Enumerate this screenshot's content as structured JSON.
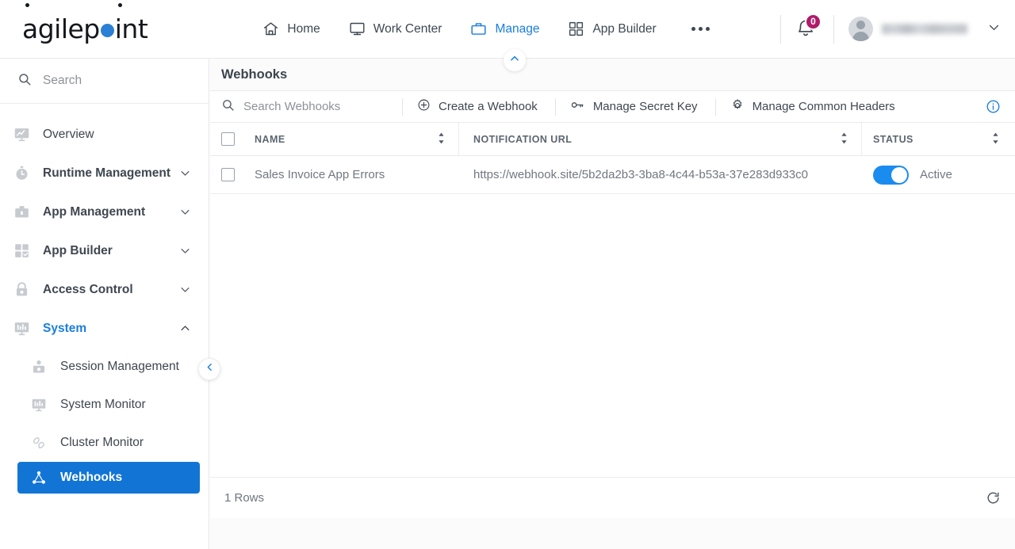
{
  "brand": {
    "logo_text_1": "agilep",
    "logo_dot": "blue-circle-dot",
    "logo_text_2": "int"
  },
  "topnav": {
    "items": [
      {
        "label": "Home",
        "icon": "home-icon",
        "active": false
      },
      {
        "label": "Work Center",
        "icon": "monitor-icon",
        "active": false
      },
      {
        "label": "Manage",
        "icon": "briefcase-icon",
        "active": true
      },
      {
        "label": "App Builder",
        "icon": "grid-icon",
        "active": false
      }
    ],
    "more_icon": "ellipsis-icon",
    "notification_icon": "bell-icon",
    "notification_count": "0",
    "notification_badge_color": "#b01b69",
    "avatar_icon": "user-avatar-icon",
    "user_name": "",
    "user_chevron_icon": "chevron-down-icon"
  },
  "sidebar": {
    "search_placeholder": "Search",
    "search_icon": "search-icon",
    "collapse_icon": "chevron-left-icon",
    "items": [
      {
        "label": "Overview",
        "icon": "overview-monitor-icon",
        "expandable": false
      },
      {
        "label": "Runtime Management",
        "icon": "stopwatch-icon",
        "expandable": true,
        "expanded": false
      },
      {
        "label": "App Management",
        "icon": "briefcase-icon",
        "expandable": true,
        "expanded": false
      },
      {
        "label": "App Builder",
        "icon": "grid-check-icon",
        "expandable": true,
        "expanded": false
      },
      {
        "label": "Access Control",
        "icon": "lock-icon",
        "expandable": true,
        "expanded": false
      },
      {
        "label": "System",
        "icon": "system-monitor-icon",
        "expandable": true,
        "expanded": true
      }
    ],
    "system_children": [
      {
        "label": "Session Management",
        "icon": "session-user-icon",
        "selected": false
      },
      {
        "label": "System Monitor",
        "icon": "system-monitor-icon",
        "selected": false
      },
      {
        "label": "Cluster Monitor",
        "icon": "cluster-icon",
        "selected": false
      },
      {
        "label": "Webhooks",
        "icon": "webhook-node-icon",
        "selected": true
      }
    ],
    "selected_color": "#1275d6",
    "active_text_color": "#1a7ee0"
  },
  "content": {
    "panel_collapse_icon": "chevron-up-icon",
    "page_title": "Webhooks",
    "toolbar": {
      "search_placeholder": "Search Webhooks",
      "search_icon": "search-icon",
      "buttons": [
        {
          "label": "Create a Webhook",
          "icon": "plus-circle-icon"
        },
        {
          "label": "Manage Secret Key",
          "icon": "key-icon"
        },
        {
          "label": "Manage Common Headers",
          "icon": "gear-icon"
        }
      ],
      "info_icon": "info-circle-icon",
      "info_color": "#1a7ee0"
    },
    "table": {
      "columns": [
        {
          "label": "NAME",
          "sortable": true
        },
        {
          "label": "NOTIFICATION URL",
          "sortable": true
        },
        {
          "label": "STATUS",
          "sortable": true
        }
      ],
      "rows": [
        {
          "name": "Sales Invoice App Errors",
          "url": "https://webhook.site/5b2da2b3-3ba8-4c44-b53a-37e283d933c0",
          "status_label": "Active",
          "status_on": true
        }
      ]
    },
    "footer": {
      "rows_count": "1 Rows",
      "refresh_icon": "refresh-icon"
    }
  }
}
